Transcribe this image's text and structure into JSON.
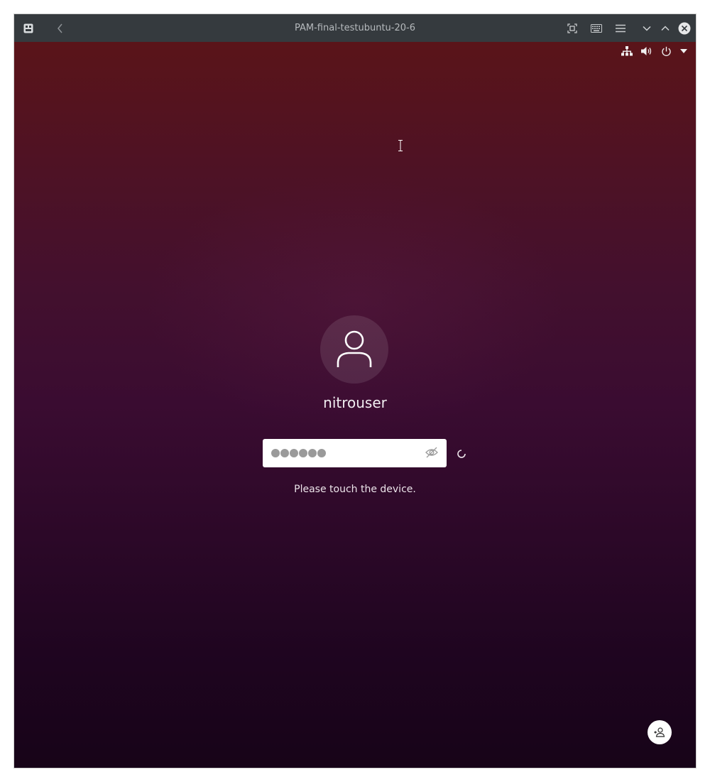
{
  "window": {
    "title": "PAM-final-testubuntu-20-6"
  },
  "titlebar_icons": [
    "app-menu-icon",
    "back-icon",
    "fullscreen-icon",
    "keyboard-icon",
    "hamburger-menu-icon",
    "minimize-icon",
    "maximize-icon",
    "close-icon"
  ],
  "top_bar": {
    "icons": [
      "network-icon",
      "volume-icon",
      "power-icon",
      "dropdown-arrow-icon"
    ]
  },
  "login": {
    "username": "nitrouser",
    "password_dots": 6,
    "status_message": "Please touch the device."
  },
  "colors": {
    "titlebar": "#353a3e",
    "bg_top": "#5a1419",
    "bg_bottom": "#170418"
  }
}
